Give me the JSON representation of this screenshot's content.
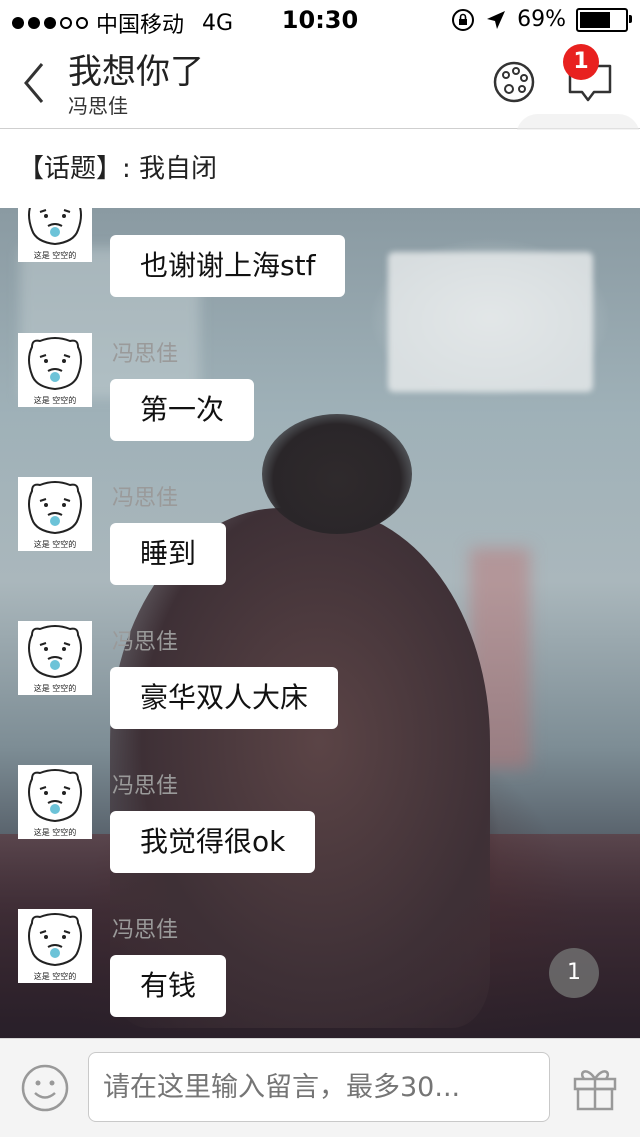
{
  "status_bar": {
    "carrier": "中国移动",
    "network": "4G",
    "time": "10:30",
    "battery": "69%",
    "battery_level": 0.69
  },
  "nav": {
    "title": "我想你了",
    "subtitle": "冯思佳",
    "notification_count": "1"
  },
  "topic": {
    "text": "【话题】: 我自闭"
  },
  "messages": [
    {
      "sender": "",
      "text": "也谢谢上海stf"
    },
    {
      "sender": "冯思佳",
      "text": "第一次"
    },
    {
      "sender": "冯思佳",
      "text": "睡到"
    },
    {
      "sender": "冯思佳",
      "text": "豪华双人大床"
    },
    {
      "sender": "冯思佳",
      "text": "我觉得很ok"
    },
    {
      "sender": "冯思佳",
      "text": "有钱"
    }
  ],
  "avatar_caption": "这是 空空的",
  "unread_count": "1",
  "input": {
    "placeholder": "请在这里输入留言，最多30..."
  },
  "icons": {
    "back": "chevron-left-icon",
    "palette": "palette-icon",
    "chat": "chat-bubble-icon",
    "emoji": "emoji-icon",
    "gift": "gift-icon"
  }
}
